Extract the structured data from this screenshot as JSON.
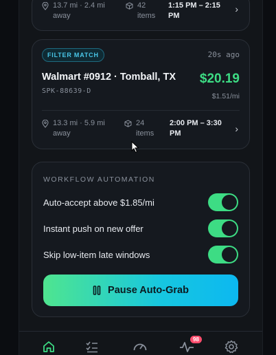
{
  "top_card": {
    "distance_line1": "13.7 mi · 2.4 mi",
    "distance_line2": "away",
    "items_line1": "42",
    "items_line2": "items",
    "time_line1": "1:15 PM – 2:15",
    "time_line2": "PM"
  },
  "offer": {
    "badge": "FILTER MATCH",
    "ago": "20s ago",
    "store": "Walmart #0912 · Tomball, TX",
    "code": "SPK-88639-D",
    "price": "$20.19",
    "rate": "$1.51/mi",
    "distance_line1": "13.3 mi · 5.9 mi",
    "distance_line2": "away",
    "items_line1": "24",
    "items_line2": "items",
    "time_line1": "2:00 PM – 3:30",
    "time_line2": "PM"
  },
  "workflow": {
    "title": "WORKFLOW AUTOMATION",
    "toggles": [
      {
        "label": "Auto-accept above $1.85/mi",
        "on": true
      },
      {
        "label": "Instant push on new offer",
        "on": true
      },
      {
        "label": "Skip low-item late windows",
        "on": true
      }
    ],
    "pause_label": "Pause Auto-Grab"
  },
  "nav": {
    "items": [
      "home-icon",
      "checklist-icon",
      "gauge-icon",
      "activity-icon",
      "gear-icon"
    ],
    "activity_badge": "98"
  },
  "colors": {
    "accent_green": "#3ddc84",
    "accent_cyan": "#17c7e0",
    "badge_red": "#ff4d6d"
  }
}
